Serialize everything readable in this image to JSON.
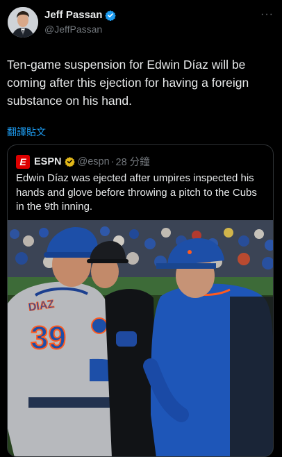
{
  "author": {
    "name": "Jeff Passan",
    "handle": "@JeffPassan"
  },
  "tweet": {
    "text": "Ten-game suspension for Edwin Díaz will be coming after this ejection for having a foreign substance on his hand.",
    "translate_label": "翻譯貼文"
  },
  "more_label": "···",
  "quoted": {
    "name": "ESPN",
    "handle": "@espn",
    "separator": "·",
    "time": "28 分鐘",
    "text": "Edwin Díaz was ejected after umpires inspected his hands and glove before throwing a pitch to the Cubs in the 9th inning.",
    "logo_letter": "E",
    "image": {
      "jersey_name": "DIAZ",
      "jersey_number": "39"
    }
  },
  "colors": {
    "accent": "#1d9bf0",
    "espn_red": "#dd0000",
    "mets_blue": "#1d4fa8",
    "mets_orange": "#ff5a1f"
  }
}
